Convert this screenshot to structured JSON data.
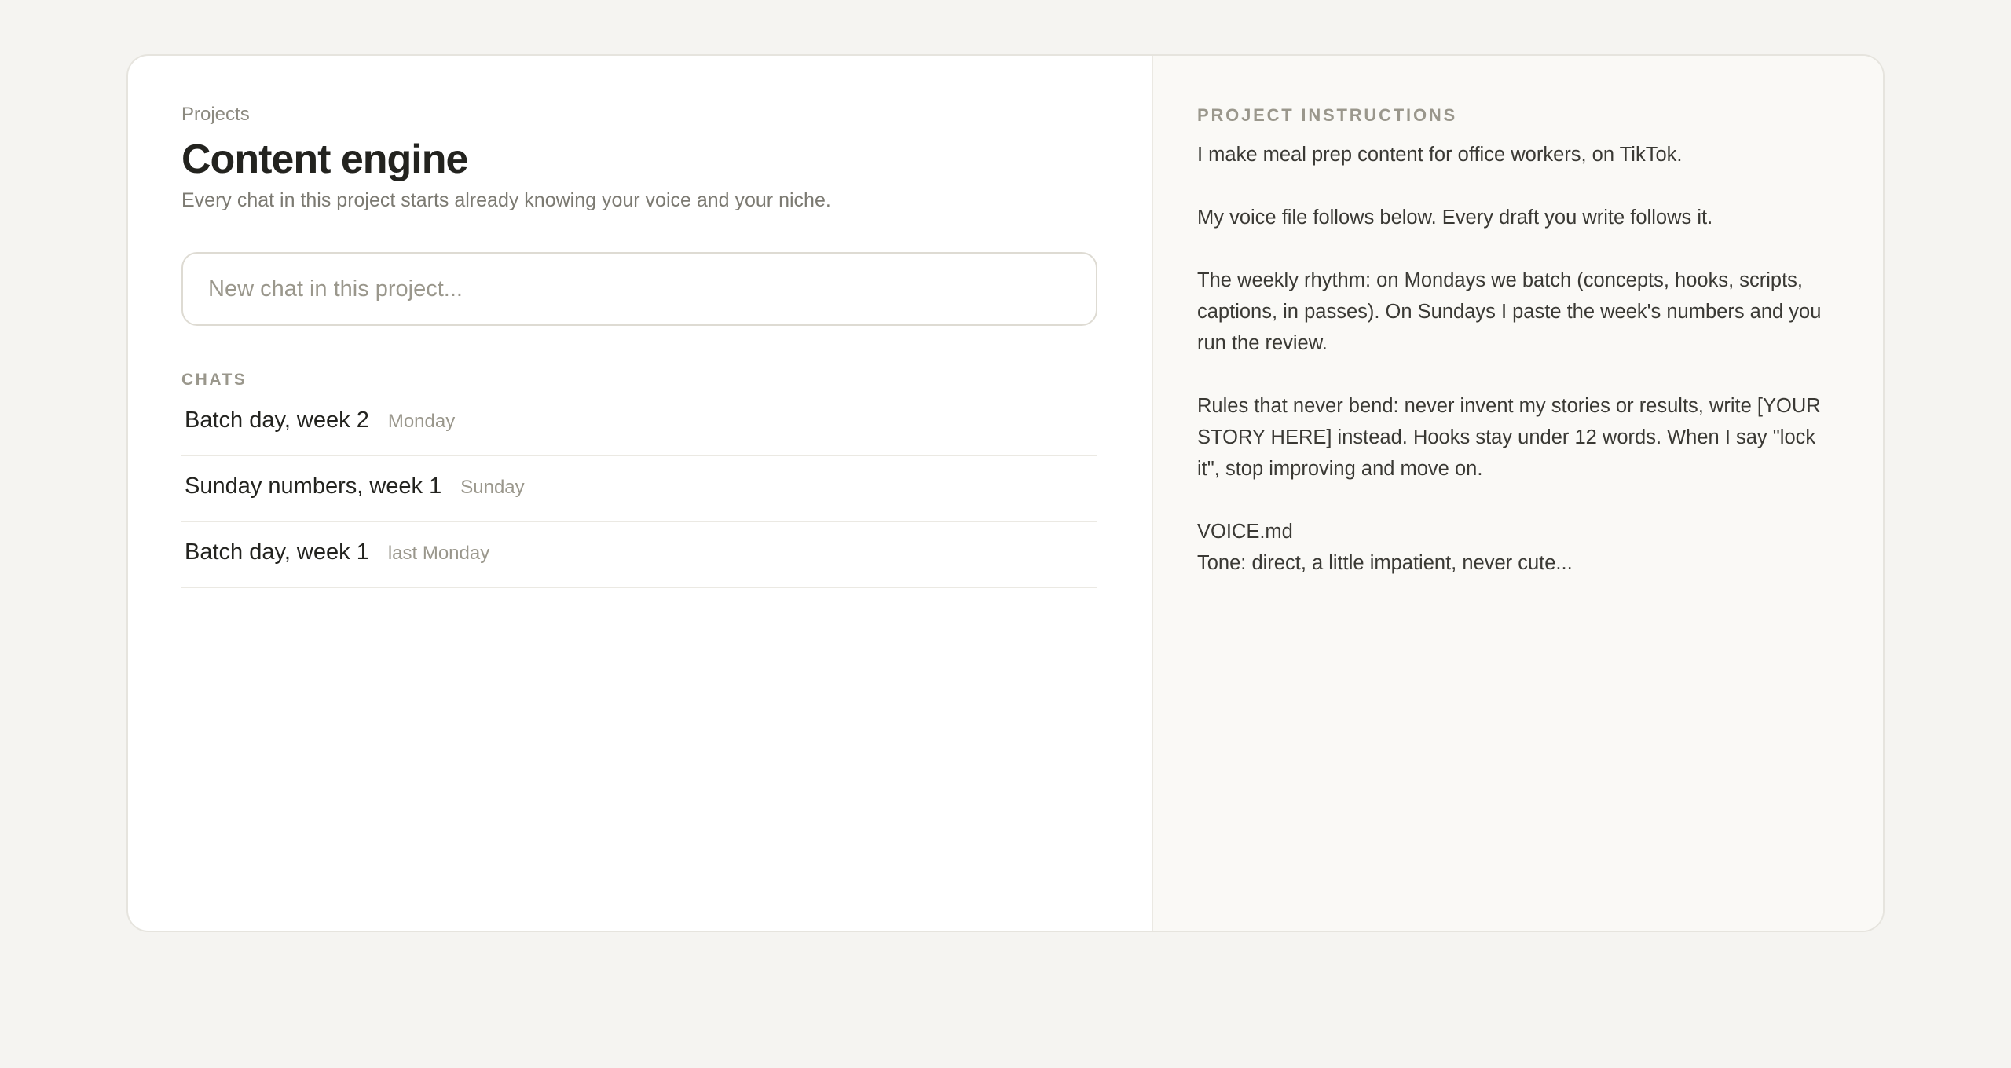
{
  "project": {
    "breadcrumb": "Projects",
    "title": "Content engine",
    "subtitle": "Every chat in this project starts already knowing your voice and your niche."
  },
  "new_chat": {
    "placeholder": "New chat in this project..."
  },
  "chats": {
    "section_label": "CHATS",
    "items": [
      {
        "title": "Batch day, week 2",
        "date": "Monday"
      },
      {
        "title": "Sunday numbers, week 1",
        "date": "Sunday"
      },
      {
        "title": "Batch day, week 1",
        "date": "last Monday"
      }
    ]
  },
  "instructions": {
    "label": "PROJECT INSTRUCTIONS",
    "paragraphs": [
      "I make meal prep content for office workers, on TikTok.",
      "My voice file follows below. Every draft you write follows it.",
      "The weekly rhythm: on Mondays we batch (concepts, hooks, scripts, captions, in passes). On Sundays I paste the week's numbers and you run the review.",
      "Rules that never bend: never invent my stories or results, write [YOUR STORY HERE] instead. Hooks stay under 12 words. When I say \"lock it\", stop improving and move on."
    ],
    "voice_file_name": "VOICE.md",
    "voice_file_preview": "Tone: direct, a little impatient, never cute..."
  }
}
